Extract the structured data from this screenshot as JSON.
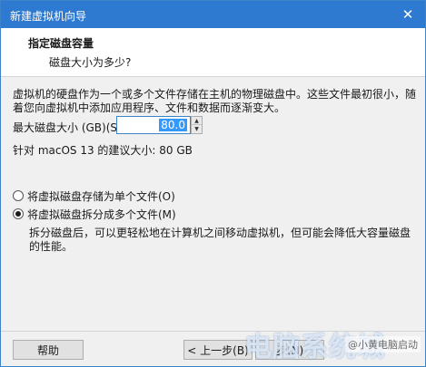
{
  "window": {
    "title": "新建虚拟机向导",
    "close_glyph": "✕"
  },
  "header": {
    "title": "指定磁盘容量",
    "subtitle": "磁盘大小为多少?"
  },
  "body": {
    "description": "虚拟机的硬盘作为一个或多个文件存储在主机的物理磁盘中。这些文件最初很小，随着您向虚拟机中添加应用程序、文件和数据而逐渐变大。",
    "max_size_label": "最大磁盘大小 (GB)(S):",
    "max_size_value": "80.0",
    "recommendation": "针对 macOS 13 的建议大小: 80 GB"
  },
  "options": [
    {
      "label": "将虚拟磁盘存储为单个文件(O)",
      "selected": false
    },
    {
      "label": "将虚拟磁盘拆分成多个文件(M)",
      "selected": true
    }
  ],
  "split_description": "拆分磁盘后，可以更轻松地在计算机之间移动虚拟机，但可能会降低大容量磁盘的性能。",
  "buttons": {
    "help": "帮助",
    "back": "< 上一步(B)",
    "next": "步(N)"
  },
  "watermark": {
    "logo": "电脑系统城",
    "tag": "@小黄电脑启动"
  },
  "colors": {
    "titlebar": "#2d7ad0",
    "accent": "#3c83c8",
    "selection": "#3399ff"
  }
}
